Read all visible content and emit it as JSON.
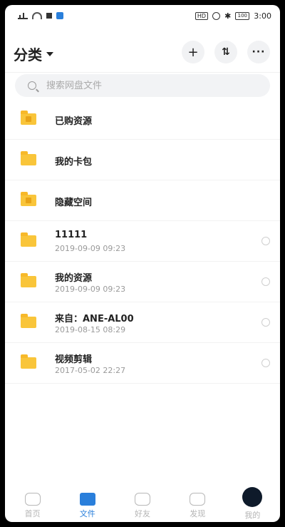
{
  "status_bar": {
    "left_icons": [
      "signal-icon",
      "wifi-icon",
      "square-icon",
      "app-notification-icon"
    ],
    "hd_label": "HD",
    "battery_label": "100",
    "time": "3:00"
  },
  "header": {
    "title": "分类",
    "buttons": [
      "add-icon",
      "sort-icon",
      "more-icon"
    ],
    "plus": "+",
    "sort": "⇅",
    "more": "···"
  },
  "search": {
    "placeholder": "搜索网盘文件"
  },
  "files": [
    {
      "name": "已购资源",
      "date": ""
    },
    {
      "name": "我的卡包",
      "date": ""
    },
    {
      "name": "隐藏空间",
      "date": ""
    },
    {
      "name": "11111",
      "date": "2019-09-09  09:23"
    },
    {
      "name": "我的资源",
      "date": "2019-09-09  09:23"
    },
    {
      "name": "来自：ANE-AL00",
      "date": "2019-08-15  08:29"
    },
    {
      "name": "视频剪辑",
      "date": "2017-05-02  22:27"
    }
  ],
  "tabs": [
    {
      "label": "首页",
      "icon": "home-icon"
    },
    {
      "label": "文件",
      "icon": "folder-icon",
      "active": true
    },
    {
      "label": "好友",
      "icon": "friends-icon"
    },
    {
      "label": "发现",
      "icon": "discover-icon"
    },
    {
      "label": "我的",
      "icon": "avatar-icon"
    }
  ],
  "colors": {
    "accent": "#2a7fdb",
    "folder": "#f9c53a"
  }
}
